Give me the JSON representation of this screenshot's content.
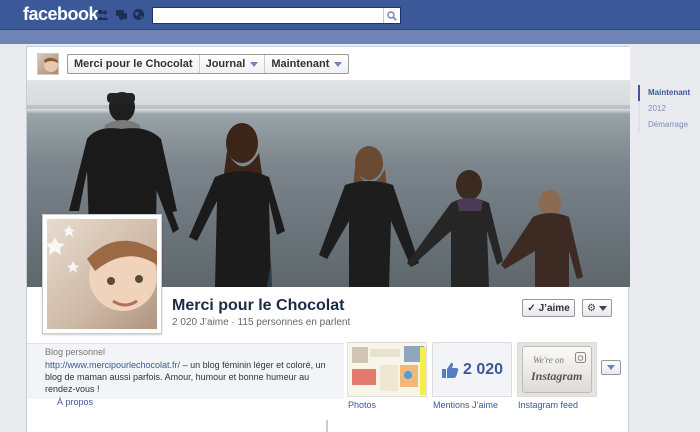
{
  "topbar": {
    "logo": "facebook",
    "search": {
      "placeholder": "",
      "value": ""
    }
  },
  "breadcrumb": {
    "items": [
      {
        "label": "Merci pour le Chocolat",
        "dropdown": false
      },
      {
        "label": "Journal",
        "dropdown": true
      },
      {
        "label": "Maintenant",
        "dropdown": true
      }
    ]
  },
  "profile": {
    "name": "Merci pour le Chocolat",
    "stats": "2 020 J’aime · 115 personnes en parlent",
    "like_button": "J’aime"
  },
  "about": {
    "type": "Blog personnel",
    "url": "http://www.mercipourlechocolat.fr/",
    "description": " – un blog féminin léger et coloré, un blog de maman aussi parfois. Amour, humour et bonne humeur au rendez-vous !",
    "link": "À propos"
  },
  "apps": {
    "photos_label": "Photos",
    "likes_count": "2 020",
    "likes_label": "Mentions J’aime",
    "instagram_line1": "We're on",
    "instagram_line2": "Instagram",
    "instagram_label": "Instagram feed"
  },
  "timeline_nav": {
    "items": [
      {
        "label": "Maintenant",
        "active": true
      },
      {
        "label": "2012",
        "active": false
      },
      {
        "label": "Démarrage",
        "active": false
      }
    ]
  },
  "colors": {
    "brand": "#3b5998",
    "subbar": "#6d84b4"
  }
}
